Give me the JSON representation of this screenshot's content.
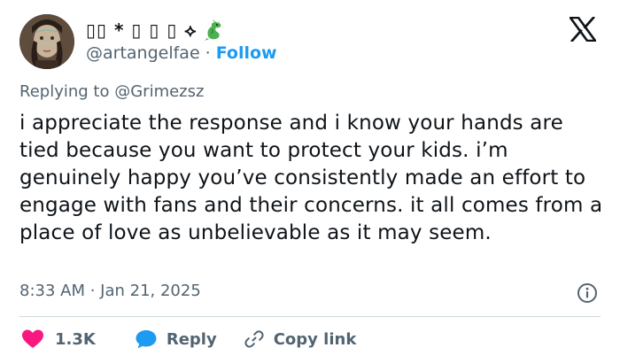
{
  "author": {
    "display_name": "▯▯ * ▯ ▯ ▯ ⟡",
    "handle": "@artangelfae",
    "separator": "·",
    "follow_label": "Follow"
  },
  "reply_context": {
    "prefix": "Replying to",
    "mention": "@Grimezsz"
  },
  "tweet": {
    "text": "i appreciate the response and i know your hands are tied because you want to protect your kids. i’m genuinely happy you’ve consistently made an effort to engage with fans and their concerns. it all comes from a place of love as unbelievable as it may seem.",
    "timestamp": "8:33 AM · Jan 21, 2025"
  },
  "actions": {
    "like_count": "1.3K",
    "reply_label": "Reply",
    "copy_link_label": "Copy link"
  },
  "colors": {
    "link": "#1d9bf0",
    "like": "#f91880",
    "reply": "#1d9bf0",
    "secondary_text": "#536471",
    "divider": "#cfd9de"
  },
  "icons": [
    "x-logo-icon",
    "dragon-emoji-icon",
    "info-icon",
    "heart-icon",
    "reply-bubble-icon",
    "link-icon"
  ]
}
